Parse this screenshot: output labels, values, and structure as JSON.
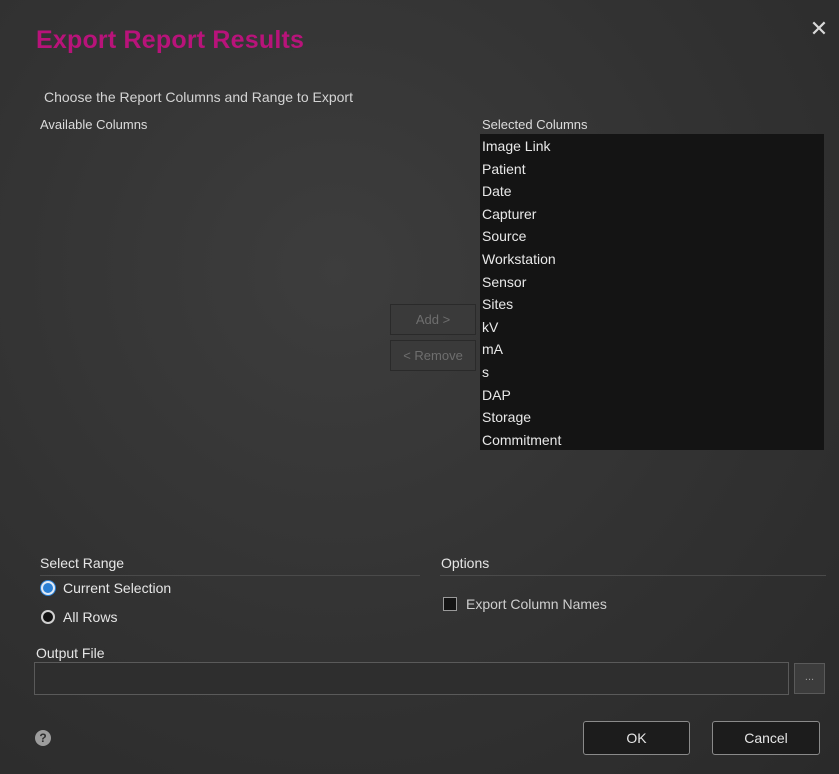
{
  "dialog": {
    "title": "Export Report Results",
    "close_glyph": "✕",
    "subtitle": "Choose the Report Columns and Range to Export",
    "colors": {
      "title": "#b8137a",
      "accent": "#2a7fd4"
    }
  },
  "columns": {
    "available_label": "Available Columns",
    "selected_label": "Selected Columns",
    "selected_items": [
      "Image Link",
      "Patient",
      "Date",
      "Capturer",
      "Source",
      "Workstation",
      "Sensor",
      "Sites",
      "kV",
      "mA",
      "s",
      "DAP",
      "Storage",
      "Commitment"
    ],
    "add_label": "Add >",
    "remove_label": "< Remove"
  },
  "range": {
    "label": "Select Range",
    "current_label": "Current Selection",
    "all_label": "All Rows",
    "selected": "current"
  },
  "options": {
    "label": "Options",
    "export_names_label": "Export Column Names",
    "export_names_checked": false
  },
  "output": {
    "label": "Output File",
    "value": "",
    "browse_label": "..."
  },
  "footer": {
    "help_glyph": "?",
    "ok_label": "OK",
    "cancel_label": "Cancel"
  }
}
